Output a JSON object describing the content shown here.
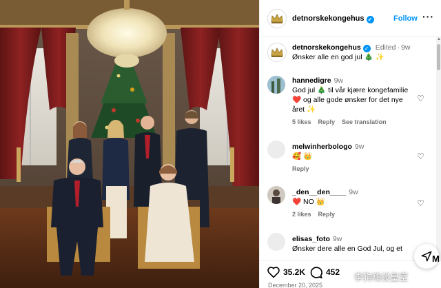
{
  "post": {
    "username": "detnorskekongehus",
    "follow_label": "Follow",
    "more_label": "···"
  },
  "caption": {
    "username": "detnorskekongehus",
    "edited": "Edited",
    "time": "9w",
    "text": "Ønsker alle en god jul 🎄 ✨"
  },
  "comments": [
    {
      "username": "hannedigre",
      "time": "9w",
      "text": "God jul 🎄 til vår kjære kongefamilie ❤️ og alle gode ønsker for det nye året ✨",
      "likes": "5 likes",
      "reply": "Reply",
      "translate": "See translation"
    },
    {
      "username": "melwinherbologo",
      "time": "9w",
      "text": "🥰 👑",
      "reply": "Reply"
    },
    {
      "username": "_den__den____",
      "time": "9w",
      "text": "❤️ NO 👑",
      "likes": "2 likes",
      "reply": "Reply"
    },
    {
      "username": "elisas_foto",
      "time": "9w",
      "text": "Ønsker dere alle en God Jul, og et"
    }
  ],
  "actions": {
    "likes_count": "35.2K",
    "comments_count": "452",
    "date": "December 20, 2025"
  },
  "dm_partial_label": "M",
  "watermark": "李狗嗨谈皇室",
  "colors": {
    "accent": "#0095f6",
    "muted": "#737373",
    "like_red": "#ed4956"
  }
}
